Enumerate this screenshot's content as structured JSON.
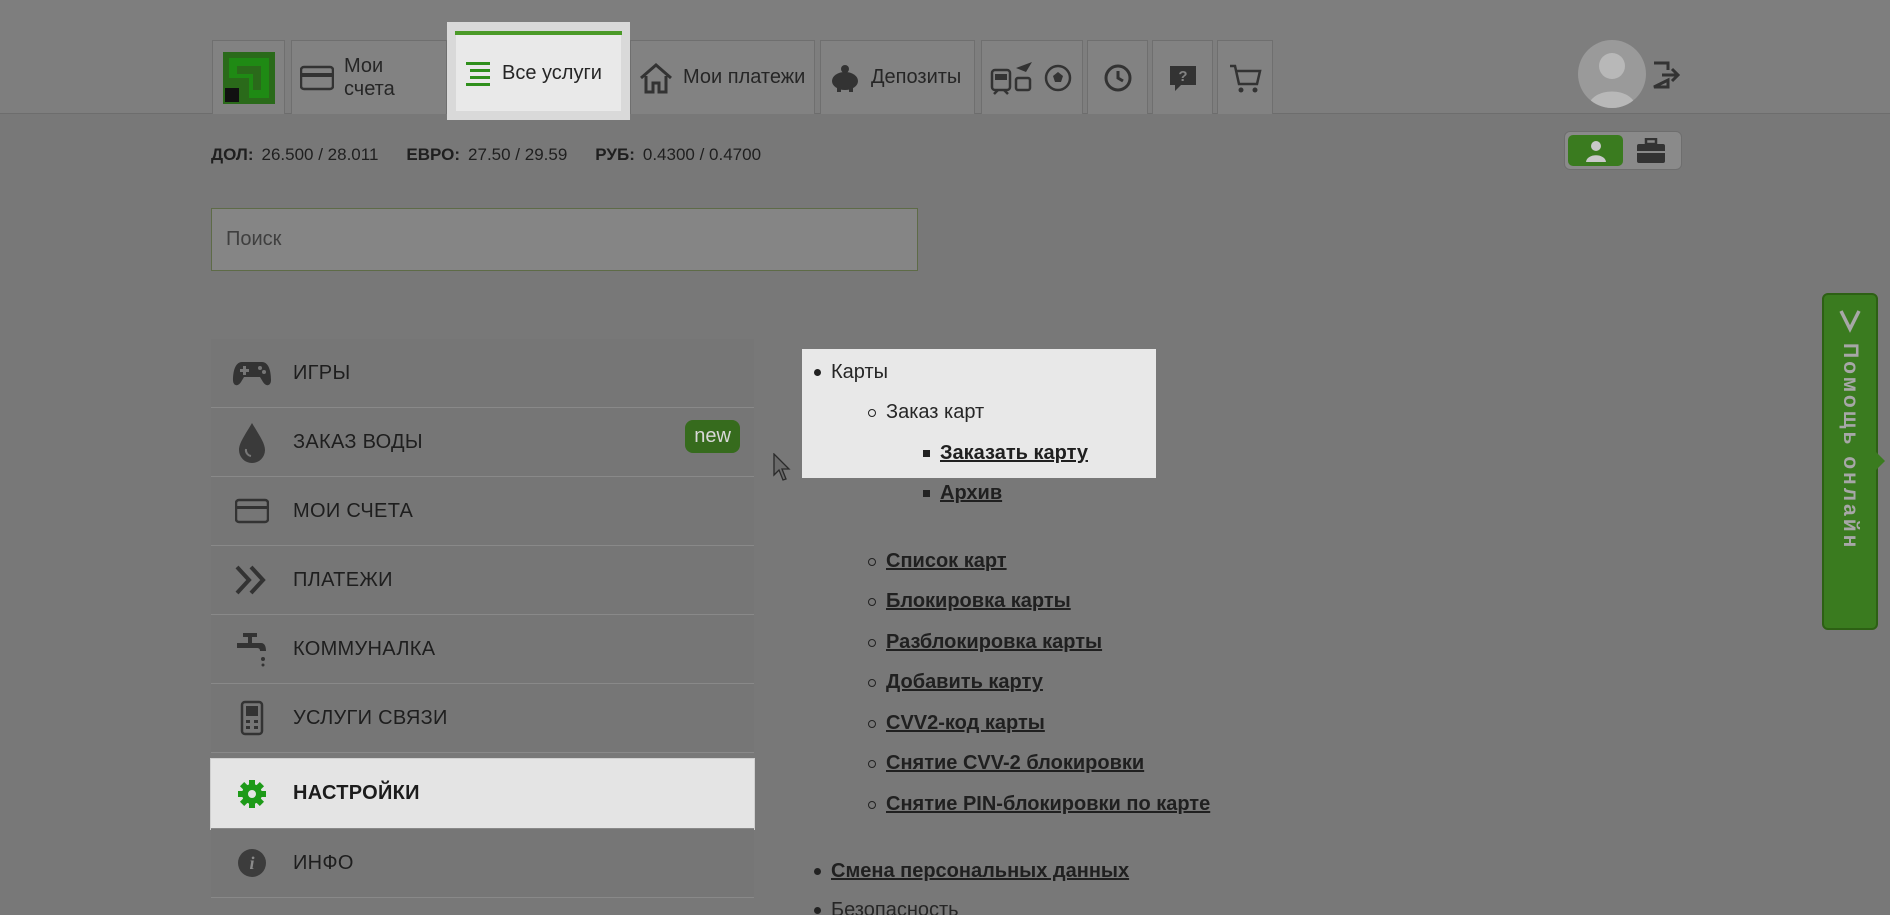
{
  "nav": {
    "tabs": [
      {
        "label": "Мои счета"
      },
      {
        "label": "Все услуги"
      },
      {
        "label": "Мои платежи"
      },
      {
        "label": "Депозиты"
      }
    ]
  },
  "rates": {
    "usd_label": "ДОЛ:",
    "usd_value": "26.500 / 28.011",
    "eur_label": "ЕВРО:",
    "eur_value": "27.50 / 29.59",
    "rub_label": "РУБ:",
    "rub_value": "0.4300 / 0.4700"
  },
  "search": {
    "placeholder": "Поиск"
  },
  "sidebar": {
    "items": [
      {
        "label": "ИГРЫ",
        "icon": "gamepad-icon"
      },
      {
        "label": "ЗАКАЗ ВОДЫ",
        "icon": "water-drop-icon",
        "badge": "new"
      },
      {
        "label": "МОИ СЧЕТА",
        "icon": "card-icon"
      },
      {
        "label": "ПЛАТЕЖИ",
        "icon": "double-chevron-icon"
      },
      {
        "label": "КОММУНАЛКА",
        "icon": "faucet-icon"
      },
      {
        "label": "УСЛУГИ СВЯЗИ",
        "icon": "phone-icon"
      },
      {
        "label": "НАСТРОЙКИ",
        "icon": "gear-icon",
        "active": true
      },
      {
        "label": "ИНФО",
        "icon": "info-icon"
      }
    ]
  },
  "tree": {
    "cards": "Карты",
    "order_cards": "Заказ карт",
    "order_card": "Заказать карту",
    "archive": "Архив",
    "card_list": "Список карт",
    "block_card": "Блокировка карты",
    "unblock_card": "Разблокировка карты",
    "add_card": "Добавить карту",
    "cvv2_code": "CVV2-код карты",
    "cvv2_unblock": "Снятие CVV-2 блокировки",
    "pin_unblock": "Снятие PIN-блокировки по карте",
    "personal_data": "Смена персональных данных",
    "security": "Безопасность"
  },
  "help": {
    "label": "Помощь онлайн"
  },
  "colors": {
    "accent": "#3a7b1f",
    "active_tab_line": "#4b9a28",
    "overlay_gray": "#787878"
  }
}
